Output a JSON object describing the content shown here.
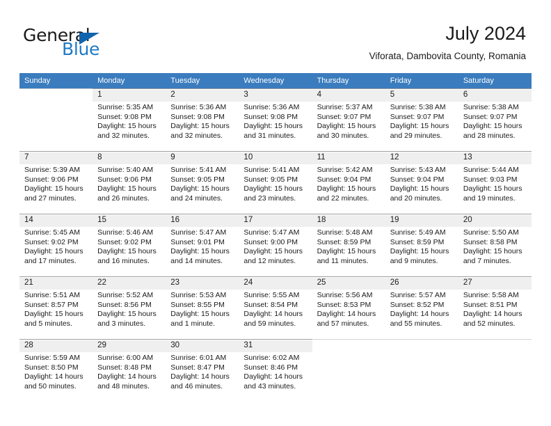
{
  "brand": {
    "name_part1": "General",
    "name_part2": "Blue",
    "triangle_color": "#1263ad",
    "blue_color": "#1f7ac4"
  },
  "header": {
    "title": "July 2024",
    "location": "Viforata, Dambovita County, Romania"
  },
  "theme": {
    "header_row_bg": "#3a7cbe",
    "header_row_text": "#ffffff",
    "daynum_bg": "#efefef",
    "grid_line": "#d2d2d2"
  },
  "weekdays": [
    "Sunday",
    "Monday",
    "Tuesday",
    "Wednesday",
    "Thursday",
    "Friday",
    "Saturday"
  ],
  "weeks": [
    [
      {
        "day": "",
        "sunrise": "",
        "sunset": "",
        "daylight1": "",
        "daylight2": ""
      },
      {
        "day": "1",
        "sunrise": "Sunrise: 5:35 AM",
        "sunset": "Sunset: 9:08 PM",
        "daylight1": "Daylight: 15 hours",
        "daylight2": "and 32 minutes."
      },
      {
        "day": "2",
        "sunrise": "Sunrise: 5:36 AM",
        "sunset": "Sunset: 9:08 PM",
        "daylight1": "Daylight: 15 hours",
        "daylight2": "and 32 minutes."
      },
      {
        "day": "3",
        "sunrise": "Sunrise: 5:36 AM",
        "sunset": "Sunset: 9:08 PM",
        "daylight1": "Daylight: 15 hours",
        "daylight2": "and 31 minutes."
      },
      {
        "day": "4",
        "sunrise": "Sunrise: 5:37 AM",
        "sunset": "Sunset: 9:07 PM",
        "daylight1": "Daylight: 15 hours",
        "daylight2": "and 30 minutes."
      },
      {
        "day": "5",
        "sunrise": "Sunrise: 5:38 AM",
        "sunset": "Sunset: 9:07 PM",
        "daylight1": "Daylight: 15 hours",
        "daylight2": "and 29 minutes."
      },
      {
        "day": "6",
        "sunrise": "Sunrise: 5:38 AM",
        "sunset": "Sunset: 9:07 PM",
        "daylight1": "Daylight: 15 hours",
        "daylight2": "and 28 minutes."
      }
    ],
    [
      {
        "day": "7",
        "sunrise": "Sunrise: 5:39 AM",
        "sunset": "Sunset: 9:06 PM",
        "daylight1": "Daylight: 15 hours",
        "daylight2": "and 27 minutes."
      },
      {
        "day": "8",
        "sunrise": "Sunrise: 5:40 AM",
        "sunset": "Sunset: 9:06 PM",
        "daylight1": "Daylight: 15 hours",
        "daylight2": "and 26 minutes."
      },
      {
        "day": "9",
        "sunrise": "Sunrise: 5:41 AM",
        "sunset": "Sunset: 9:05 PM",
        "daylight1": "Daylight: 15 hours",
        "daylight2": "and 24 minutes."
      },
      {
        "day": "10",
        "sunrise": "Sunrise: 5:41 AM",
        "sunset": "Sunset: 9:05 PM",
        "daylight1": "Daylight: 15 hours",
        "daylight2": "and 23 minutes."
      },
      {
        "day": "11",
        "sunrise": "Sunrise: 5:42 AM",
        "sunset": "Sunset: 9:04 PM",
        "daylight1": "Daylight: 15 hours",
        "daylight2": "and 22 minutes."
      },
      {
        "day": "12",
        "sunrise": "Sunrise: 5:43 AM",
        "sunset": "Sunset: 9:04 PM",
        "daylight1": "Daylight: 15 hours",
        "daylight2": "and 20 minutes."
      },
      {
        "day": "13",
        "sunrise": "Sunrise: 5:44 AM",
        "sunset": "Sunset: 9:03 PM",
        "daylight1": "Daylight: 15 hours",
        "daylight2": "and 19 minutes."
      }
    ],
    [
      {
        "day": "14",
        "sunrise": "Sunrise: 5:45 AM",
        "sunset": "Sunset: 9:02 PM",
        "daylight1": "Daylight: 15 hours",
        "daylight2": "and 17 minutes."
      },
      {
        "day": "15",
        "sunrise": "Sunrise: 5:46 AM",
        "sunset": "Sunset: 9:02 PM",
        "daylight1": "Daylight: 15 hours",
        "daylight2": "and 16 minutes."
      },
      {
        "day": "16",
        "sunrise": "Sunrise: 5:47 AM",
        "sunset": "Sunset: 9:01 PM",
        "daylight1": "Daylight: 15 hours",
        "daylight2": "and 14 minutes."
      },
      {
        "day": "17",
        "sunrise": "Sunrise: 5:47 AM",
        "sunset": "Sunset: 9:00 PM",
        "daylight1": "Daylight: 15 hours",
        "daylight2": "and 12 minutes."
      },
      {
        "day": "18",
        "sunrise": "Sunrise: 5:48 AM",
        "sunset": "Sunset: 8:59 PM",
        "daylight1": "Daylight: 15 hours",
        "daylight2": "and 11 minutes."
      },
      {
        "day": "19",
        "sunrise": "Sunrise: 5:49 AM",
        "sunset": "Sunset: 8:59 PM",
        "daylight1": "Daylight: 15 hours",
        "daylight2": "and 9 minutes."
      },
      {
        "day": "20",
        "sunrise": "Sunrise: 5:50 AM",
        "sunset": "Sunset: 8:58 PM",
        "daylight1": "Daylight: 15 hours",
        "daylight2": "and 7 minutes."
      }
    ],
    [
      {
        "day": "21",
        "sunrise": "Sunrise: 5:51 AM",
        "sunset": "Sunset: 8:57 PM",
        "daylight1": "Daylight: 15 hours",
        "daylight2": "and 5 minutes."
      },
      {
        "day": "22",
        "sunrise": "Sunrise: 5:52 AM",
        "sunset": "Sunset: 8:56 PM",
        "daylight1": "Daylight: 15 hours",
        "daylight2": "and 3 minutes."
      },
      {
        "day": "23",
        "sunrise": "Sunrise: 5:53 AM",
        "sunset": "Sunset: 8:55 PM",
        "daylight1": "Daylight: 15 hours",
        "daylight2": "and 1 minute."
      },
      {
        "day": "24",
        "sunrise": "Sunrise: 5:55 AM",
        "sunset": "Sunset: 8:54 PM",
        "daylight1": "Daylight: 14 hours",
        "daylight2": "and 59 minutes."
      },
      {
        "day": "25",
        "sunrise": "Sunrise: 5:56 AM",
        "sunset": "Sunset: 8:53 PM",
        "daylight1": "Daylight: 14 hours",
        "daylight2": "and 57 minutes."
      },
      {
        "day": "26",
        "sunrise": "Sunrise: 5:57 AM",
        "sunset": "Sunset: 8:52 PM",
        "daylight1": "Daylight: 14 hours",
        "daylight2": "and 55 minutes."
      },
      {
        "day": "27",
        "sunrise": "Sunrise: 5:58 AM",
        "sunset": "Sunset: 8:51 PM",
        "daylight1": "Daylight: 14 hours",
        "daylight2": "and 52 minutes."
      }
    ],
    [
      {
        "day": "28",
        "sunrise": "Sunrise: 5:59 AM",
        "sunset": "Sunset: 8:50 PM",
        "daylight1": "Daylight: 14 hours",
        "daylight2": "and 50 minutes."
      },
      {
        "day": "29",
        "sunrise": "Sunrise: 6:00 AM",
        "sunset": "Sunset: 8:48 PM",
        "daylight1": "Daylight: 14 hours",
        "daylight2": "and 48 minutes."
      },
      {
        "day": "30",
        "sunrise": "Sunrise: 6:01 AM",
        "sunset": "Sunset: 8:47 PM",
        "daylight1": "Daylight: 14 hours",
        "daylight2": "and 46 minutes."
      },
      {
        "day": "31",
        "sunrise": "Sunrise: 6:02 AM",
        "sunset": "Sunset: 8:46 PM",
        "daylight1": "Daylight: 14 hours",
        "daylight2": "and 43 minutes."
      },
      {
        "day": "",
        "sunrise": "",
        "sunset": "",
        "daylight1": "",
        "daylight2": ""
      },
      {
        "day": "",
        "sunrise": "",
        "sunset": "",
        "daylight1": "",
        "daylight2": ""
      },
      {
        "day": "",
        "sunrise": "",
        "sunset": "",
        "daylight1": "",
        "daylight2": ""
      }
    ]
  ]
}
